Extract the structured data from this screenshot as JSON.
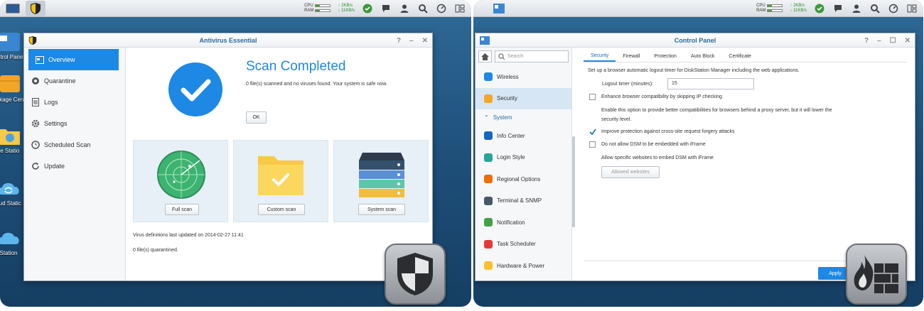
{
  "left": {
    "taskbar": {
      "cpu_label": "CPU",
      "ram_label": "RAM",
      "up": "2KB/s",
      "down": "11KB/s",
      "cpu_level": 0.3,
      "ram_level": 0.3
    },
    "desktop_icons": [
      {
        "label": "ontrol Pane"
      },
      {
        "label": "Package Center"
      },
      {
        "label": "ile Statio"
      },
      {
        "label": "oud Static"
      },
      {
        "label": "Station"
      }
    ],
    "window": {
      "title": "Antivirus Essential",
      "nav": [
        {
          "label": "Overview"
        },
        {
          "label": "Quarantine"
        },
        {
          "label": "Logs"
        },
        {
          "label": "Settings"
        },
        {
          "label": "Scheduled Scan"
        },
        {
          "label": "Update"
        }
      ],
      "heading": "Scan Completed",
      "summary": "0 file(s) scanned and no viruses found. Your system is safe now.",
      "ok_label": "OK",
      "scans": [
        {
          "label": "Full scan"
        },
        {
          "label": "Custom scan"
        },
        {
          "label": "System scan"
        }
      ],
      "definitions": "Virus definitions last updated on 2014-02-27 11:41",
      "quarantined": "0 file(s) quarantined."
    }
  },
  "right": {
    "taskbar": {
      "cpu_label": "CPU",
      "ram_label": "RAM",
      "up": "2KB/s",
      "down": "11KB/s",
      "cpu_level": 0.3,
      "ram_level": 0.3
    },
    "window": {
      "title": "Control Panel",
      "search_placeholder": "Search",
      "nav": [
        {
          "label": "Wireless",
          "color": "#1e88e5"
        },
        {
          "label": "Security",
          "color": "#f5a623"
        },
        {
          "label": "System",
          "group": true
        },
        {
          "label": "Info Center",
          "color": "#1565c0"
        },
        {
          "label": "Login Style",
          "color": "#26a69a"
        },
        {
          "label": "Regional Options",
          "color": "#ef6c00"
        },
        {
          "label": "Terminal & SNMP",
          "color": "#455a64"
        },
        {
          "label": "Notification",
          "color": "#43a047"
        },
        {
          "label": "Task Scheduler",
          "color": "#e53935"
        },
        {
          "label": "Hardware & Power",
          "color": "#fbc02d"
        }
      ],
      "tabs": [
        {
          "label": "Security"
        },
        {
          "label": "Firewall"
        },
        {
          "label": "Protection"
        },
        {
          "label": "Auto Block"
        },
        {
          "label": "Certificate"
        }
      ],
      "intro": "Set up a browser automatic logout timer for DiskStation Manager including the web applications.",
      "logout_label": "Logout timer (minutes):",
      "logout_value": "15",
      "opt1": "Enhance browser compatibility by skipping IP checking",
      "opt1_desc": "Enable this option to provide better compatibilities for browsers behind a proxy server, but it will lower the",
      "opt1_desc2": "security level.",
      "opt2": "Improve protection against cross-site request forgery attacks",
      "opt3": "Do not allow DSM to be embedded with iFrame",
      "opt3_desc": "Allow specific websites to embed DSM with iFrame",
      "allowed_label": "Allowed websites",
      "apply_label": "Apply"
    }
  },
  "colors": {
    "accent": "#1e88e5",
    "check_blue": "#1e88e5",
    "radar_green": "#3cb371",
    "folder_yellow": "#f7c948"
  }
}
